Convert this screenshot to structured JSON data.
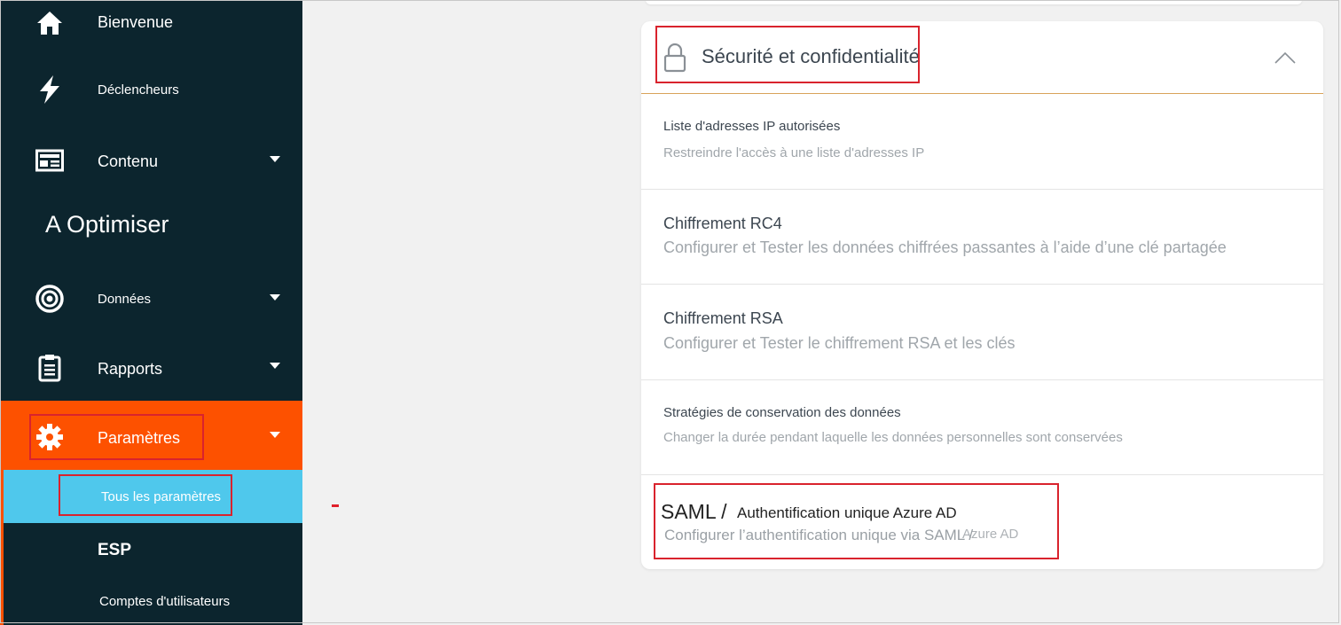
{
  "sidebar": {
    "items": [
      {
        "label": "Bienvenue",
        "icon": "home-icon"
      },
      {
        "label": "Déclencheurs",
        "icon": "lightning-icon"
      },
      {
        "label": "Contenu",
        "icon": "newspaper-icon"
      },
      {
        "label": "Données",
        "icon": "target-icon"
      },
      {
        "label": "Rapports",
        "icon": "clipboard-icon"
      },
      {
        "label": "Paramètres",
        "icon": "gear-icon"
      }
    ],
    "section_title": "A Optimiser",
    "subitems": [
      {
        "label": "Tous les paramètres"
      },
      {
        "label": "ESP"
      },
      {
        "label": "Comptes d'utilisateurs"
      }
    ]
  },
  "panel": {
    "title": "Sécurité et confidentialité",
    "rows": [
      {
        "title": "Liste d'adresses IP autorisées",
        "subtitle": "Restreindre l'accès à une liste d'adresses IP"
      },
      {
        "title": "Chiffrement RC4",
        "subtitle": "Configurer et Tester les données chiffrées passantes à l’aide d’une clé partagée"
      },
      {
        "title": "Chiffrement RSA",
        "subtitle": "Configurer et Tester le chiffrement RSA et les clés"
      },
      {
        "title": "Stratégies de conservation des données",
        "subtitle": "Changer la durée pendant laquelle les données personnelles sont conservées"
      }
    ],
    "saml": {
      "prefix": "SAML /",
      "title": "Authentification unique Azure AD",
      "subtitle": "Configurer l’authentification unique via SAML /",
      "overlap": "Azure AD"
    }
  },
  "colors": {
    "sidebar_bg": "#0c252e",
    "active_item": "#fd5100",
    "active_subitem": "#4fc8ec",
    "highlight_box": "#d9232d",
    "header_divider": "#d9a35a"
  }
}
